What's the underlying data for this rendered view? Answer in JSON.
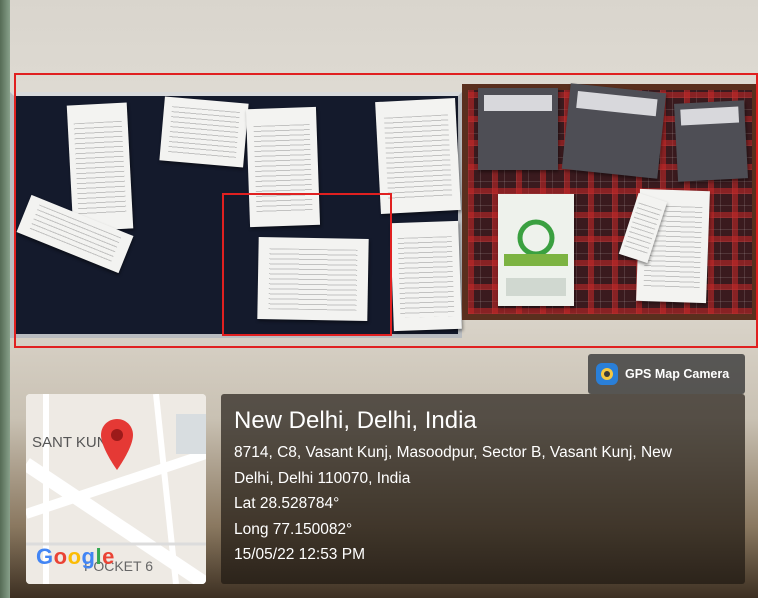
{
  "scene": {
    "subject": "notice boards with pinned papers",
    "accent_color": "#e02020"
  },
  "badge": {
    "label": "GPS Map Camera",
    "icon": "camera-lens-icon"
  },
  "map": {
    "street_label": "SANT KUN",
    "sector_label": "POCKET 6",
    "logo": "Google",
    "pin_icon": "location-pin-icon"
  },
  "location": {
    "title": "New Delhi, Delhi, India",
    "address_line1": "8714, C8, Vasant Kunj, Masoodpur, Sector B, Vasant Kunj, New",
    "address_line2": "Delhi, Delhi 110070, India",
    "lat": "Lat 28.528784°",
    "long": "Long 77.150082°",
    "datetime": "15/05/22 12:53 PM"
  }
}
